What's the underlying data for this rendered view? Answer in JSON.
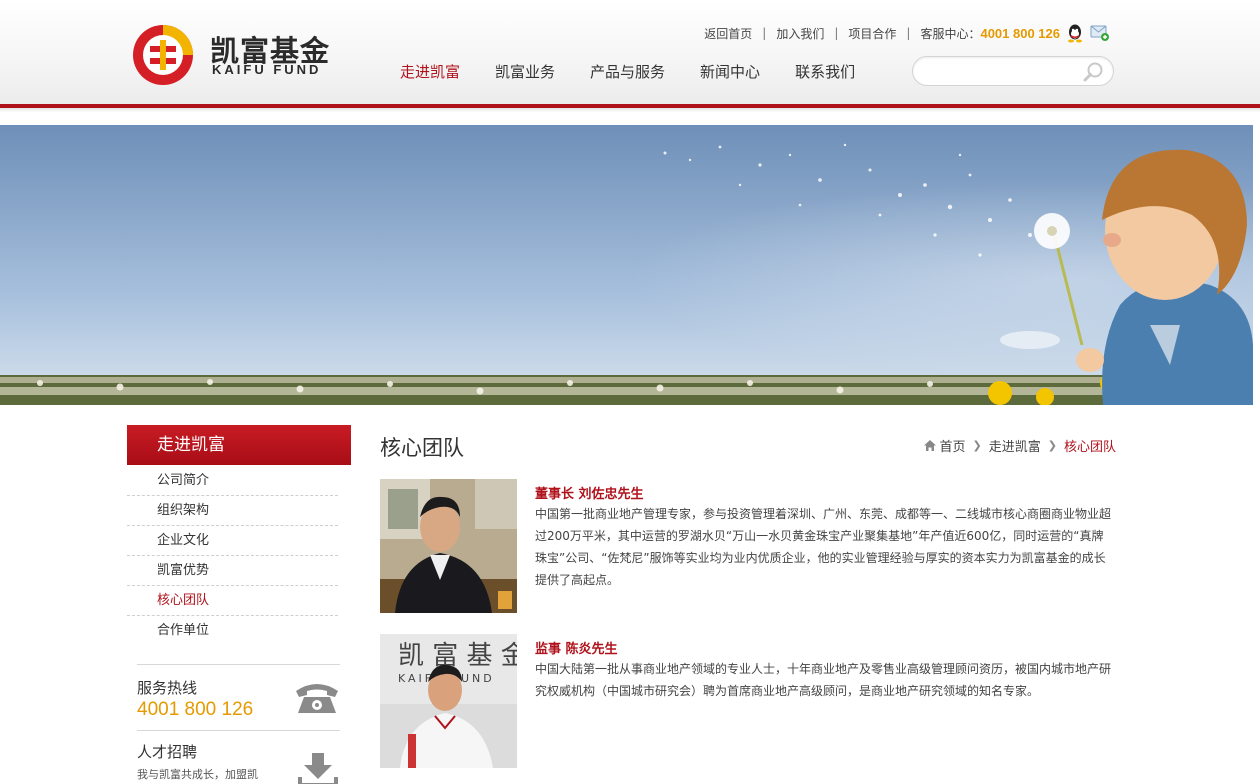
{
  "brand": {
    "name_cn": "凯富基金",
    "name_en": "KAIFU FUND"
  },
  "top_links": {
    "home": "返回首页",
    "join": "加入我们",
    "cooperate": "项目合作",
    "service_label": "客服中心：",
    "hotline": "4001 800 126"
  },
  "nav": [
    {
      "label": "走进凯富",
      "active": true
    },
    {
      "label": "凯富业务",
      "active": false
    },
    {
      "label": "产品与服务",
      "active": false
    },
    {
      "label": "新闻中心",
      "active": false
    },
    {
      "label": "联系我们",
      "active": false
    }
  ],
  "search": {
    "placeholder": "",
    "value": ""
  },
  "sidebar": {
    "title": "走进凯富",
    "items": [
      {
        "label": "公司简介"
      },
      {
        "label": "组织架构"
      },
      {
        "label": "企业文化"
      },
      {
        "label": "凯富优势"
      },
      {
        "label": "核心团队"
      },
      {
        "label": "合作单位"
      }
    ],
    "active_index": 4,
    "service": {
      "label": "服务热线",
      "phone": "4001 800 126"
    },
    "recruit": {
      "label": "人才招聘",
      "desc": "我与凯富共成长，加盟凯"
    }
  },
  "main": {
    "title": "核心团队",
    "breadcrumb": {
      "home": "首页",
      "parent": "走进凯富",
      "current": "核心团队"
    },
    "members": [
      {
        "name": "董事长 刘佐忠先生",
        "bio": "中国第一批商业地产管理专家，参与投资管理着深圳、广州、东莞、成都等一、二线城市核心商圈商业物业超过200万平米，其中运营的罗湖水贝“万山一水贝黄金珠宝产业聚集基地”年产值近600亿，同时运营的“真牌珠宝”公司、“佐梵尼”服饰等实业均为业内优质企业，他的实业管理经验与厚实的资本实力为凯富基金的成长提供了高起点。"
      },
      {
        "name": "监事 陈炎先生",
        "bio": "中国大陆第一批从事商业地产领域的专业人士，十年商业地产及零售业高级管理顾问资历，被国内城市地产研究权威机构（中国城市研究会）聘为首席商业地产高级顾问，是商业地产研究领域的知名专家。"
      }
    ]
  },
  "colors": {
    "brand_red": "#b0121b",
    "accent_orange": "#e59a00"
  }
}
